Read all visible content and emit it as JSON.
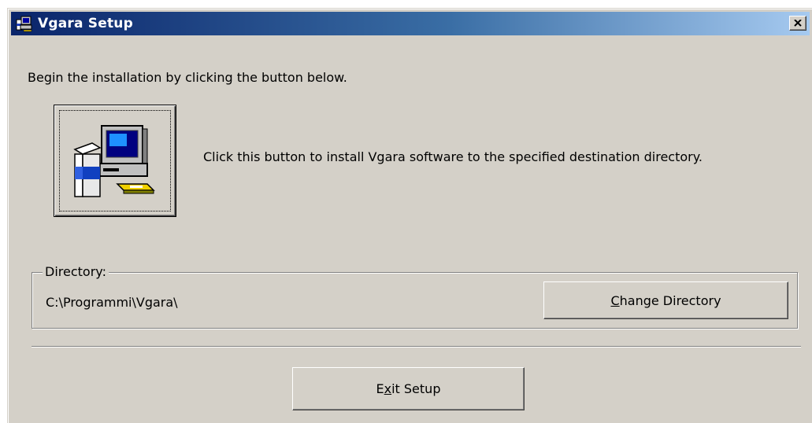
{
  "window": {
    "title": "Vgara Setup",
    "icon": "setup-computer-icon",
    "close_icon": "close-icon"
  },
  "instruction": "Begin the installation by clicking the button below.",
  "install": {
    "icon": "install-computer-icon",
    "description": "Click this button to install Vgara software to the specified destination directory."
  },
  "directory": {
    "group_label": "Directory:",
    "path": "C:\\Programmi\\Vgara\\",
    "change_button": {
      "mnemonic": "C",
      "rest": "hange Directory"
    }
  },
  "exit_button": {
    "before": "E",
    "mnemonic": "x",
    "after": "it Setup"
  },
  "colors": {
    "dialog_bg": "#d4d0c8",
    "titlebar_start": "#0a246a",
    "titlebar_end": "#a6caf0"
  }
}
